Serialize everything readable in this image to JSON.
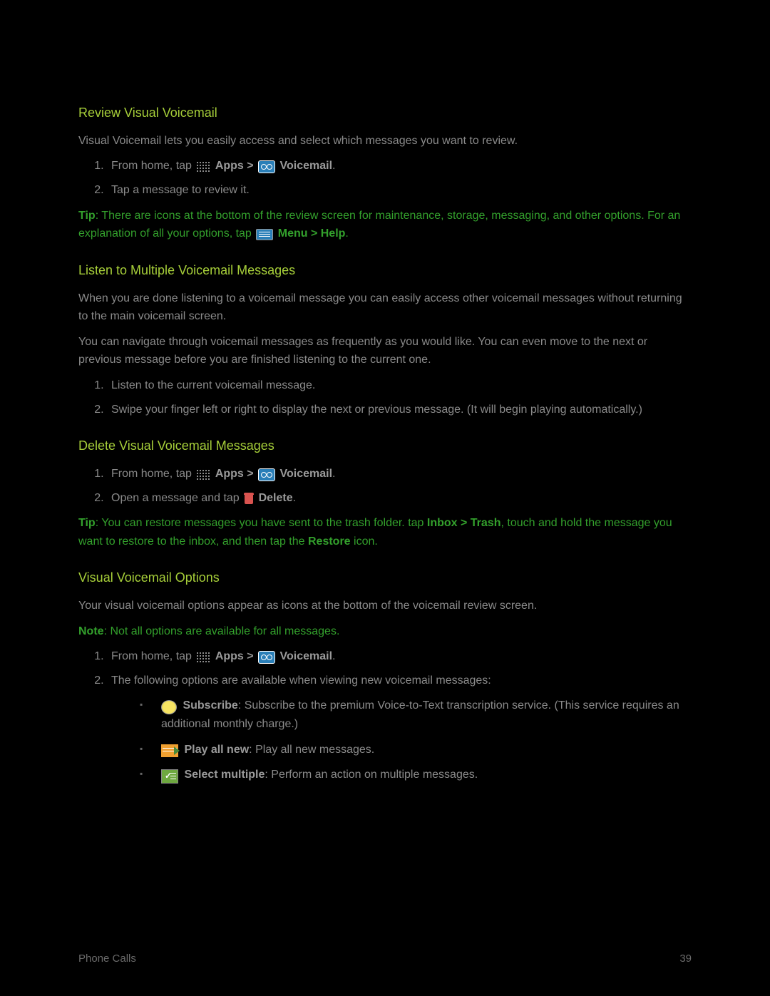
{
  "sections": {
    "review": {
      "heading": "Review Visual Voicemail",
      "intro": "Visual Voicemail lets you easily access and select which messages you want to review.",
      "step1_prefix": "From home, tap ",
      "apps_label": "Apps > ",
      "voicemail_label": "Voicemail",
      "step2": "Tap a message to review it.",
      "tip_label": "Tip",
      "tip_line1": ": There are icons at the bottom of the review screen for maintenance, storage, messaging, and other",
      "tip_line2_prefix": "options. For an explanation of all your options, tap ",
      "menu_help": "Menu > Help"
    },
    "listen": {
      "heading": "Listen to Multiple Voicemail Messages",
      "p1": "When you are done listening to a voicemail message you can easily access other voicemail messages without returning to the main voicemail screen.",
      "p2": "You can navigate through voicemail messages as frequently as you would like. You can even move to the next or previous message before you are finished listening to the current one.",
      "step1": "Listen to the current voicemail message.",
      "step2": "Swipe your finger left or right to display the next or previous message. (It will begin playing automatically.)"
    },
    "delete": {
      "heading": "Delete Visual Voicemail Messages",
      "step1_prefix": "From home, tap ",
      "apps_label": "Apps > ",
      "voicemail_label": "Voicemail",
      "step2_prefix": "Open a message and tap ",
      "delete_label": "Delete",
      "tip_label": "Tip",
      "tip_part1": ": You can restore messages you have sent to the trash folder. tap ",
      "inbox_trash": "Inbox > Trash",
      "tip_part2": ", touch and hold the message you want to restore to the inbox, and then tap the ",
      "restore": "Restore",
      "tip_part3": " icon."
    },
    "options": {
      "heading": "Visual Voicemail Options",
      "intro": "Your visual voicemail options appear as icons at the bottom of the voicemail review screen.",
      "note_label": "Note",
      "note_text": ": Not all options are available for all messages.",
      "step1_prefix": "From home, tap ",
      "apps_label": "Apps > ",
      "voicemail_label": "Voicemail",
      "step2": "The following options are available when viewing new voicemail messages:",
      "subscribe_label": "Subscribe",
      "subscribe_text": ": Subscribe to the premium Voice-to-Text transcription service. (This service requires an additional monthly charge.)",
      "play_label": "Play all new",
      "play_text": ": Play all new messages.",
      "select_label": "Select multiple",
      "select_text": ": Perform an action on multiple messages."
    }
  },
  "footer": {
    "left": "Phone Calls",
    "right": "39"
  }
}
